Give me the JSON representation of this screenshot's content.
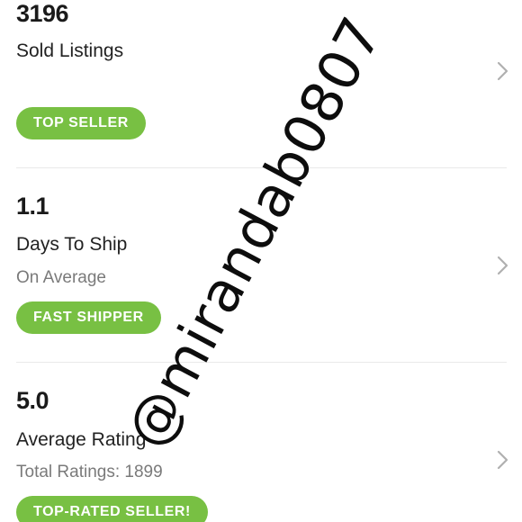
{
  "stats": [
    {
      "value": "3196",
      "label": "Sold Listings",
      "sublabel": "",
      "badge": "TOP SELLER"
    },
    {
      "value": "1.1",
      "label": "Days To Ship",
      "sublabel": "On Average",
      "badge": "FAST SHIPPER"
    },
    {
      "value": "5.0",
      "label": "Average Rating",
      "sublabel": "Total Ratings: 1899",
      "badge": "TOP-RATED SELLER!"
    }
  ],
  "watermark": "@mirandab0807",
  "icons": {
    "chevron": "chevron-right-icon"
  },
  "colors": {
    "badge_bg": "#78c043",
    "badge_text": "#ffffff",
    "primary_text": "#1a1a1a",
    "secondary_text": "#7a7a7a",
    "divider": "#e9e9e9",
    "chevron": "#b0b0b0"
  }
}
